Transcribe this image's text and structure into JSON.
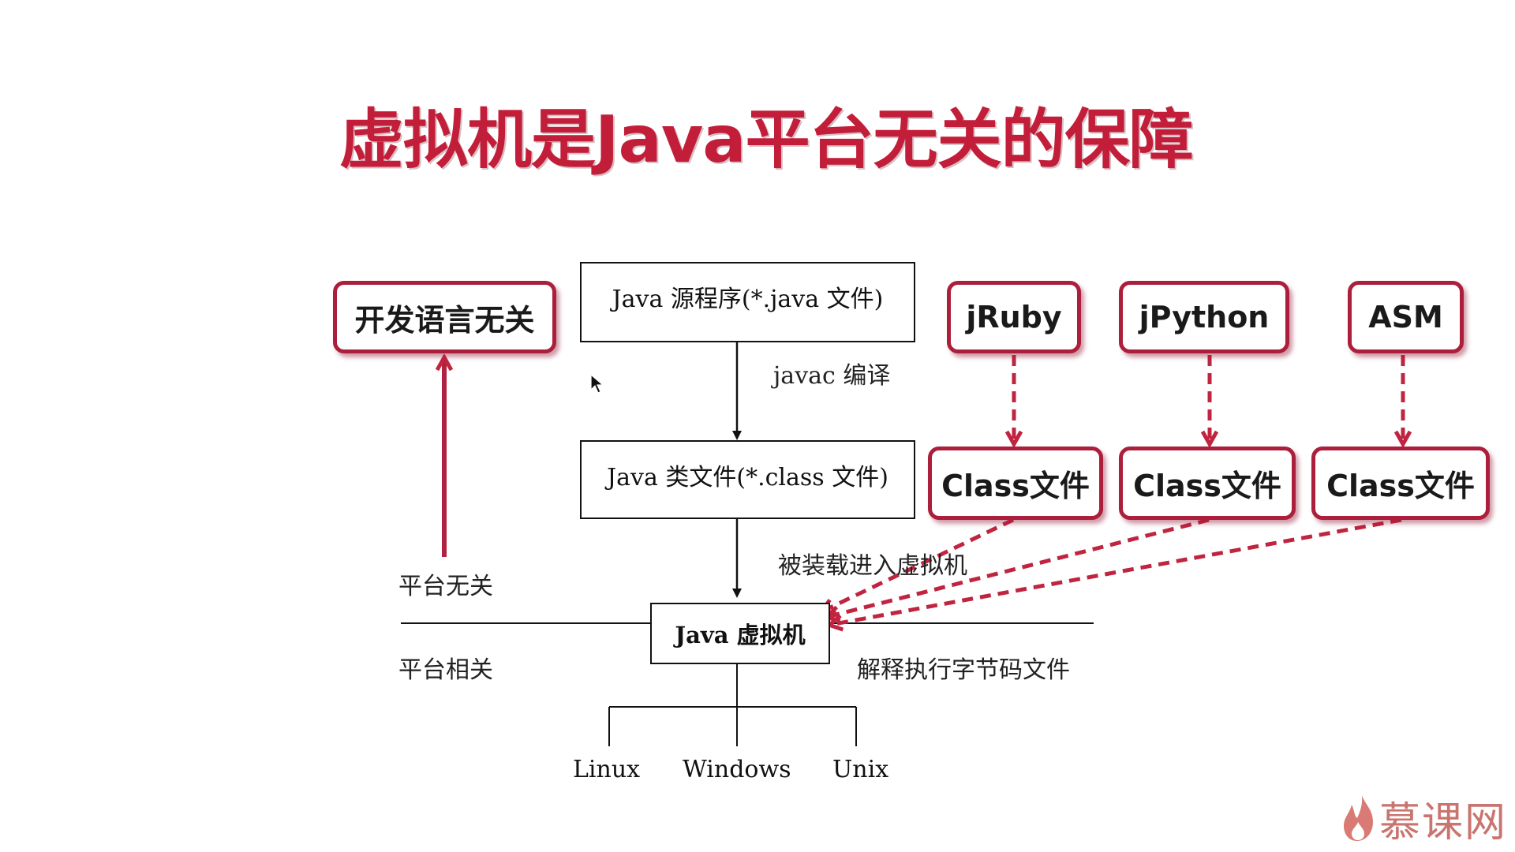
{
  "title": "虚拟机是Java平台无关的保障",
  "boxes": {
    "lang_independent": "开发语言无关",
    "java_source": "Java 源程序(*.java 文件)",
    "java_class": "Java 类文件(*.class 文件)",
    "jvm": "Java 虚拟机",
    "jruby": "jRuby",
    "jpython": "jPython",
    "asm": "ASM",
    "class_file_1": "Class文件",
    "class_file_2": "Class文件",
    "class_file_3": "Class文件"
  },
  "labels": {
    "javac": "javac 编译",
    "loaded": "被装载进入虚拟机",
    "platform_independent": "平台无关",
    "platform_dependent": "平台相关",
    "interpret": "解释执行字节码文件"
  },
  "os": [
    "Linux",
    "Windows",
    "Unix"
  ],
  "logo": {
    "text": "慕课网"
  },
  "colors": {
    "accent": "#c21e3a",
    "box_border": "#ab1f3c",
    "logo": "#c9746e"
  }
}
